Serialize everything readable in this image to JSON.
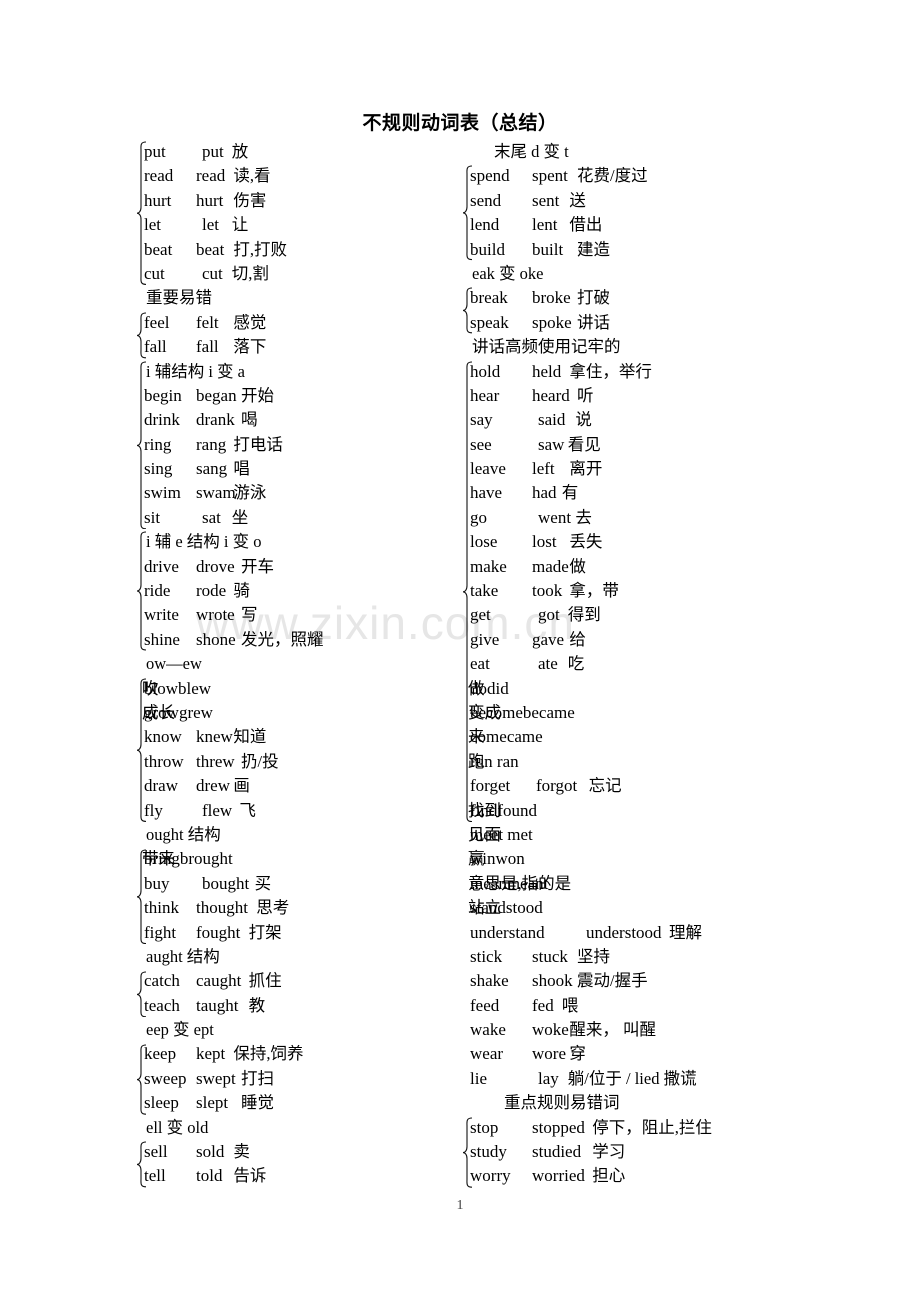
{
  "document": {
    "title": "不规则动词表（总结）",
    "page_number": "1",
    "watermark": "www.zixin.com.cn"
  },
  "left_column": {
    "rows": [
      {
        "kind": "verb",
        "base": "put",
        "past": "put",
        "mean": "放"
      },
      {
        "kind": "verb",
        "base": "read",
        "past": "read",
        "mean": "读,看"
      },
      {
        "kind": "verb",
        "base": "hurt",
        "past": "hurt",
        "mean": "伤害"
      },
      {
        "kind": "verb",
        "base": "let",
        "past": "let",
        "mean": "让"
      },
      {
        "kind": "verb",
        "base": "beat",
        "past": "beat",
        "mean": "打,打败"
      },
      {
        "kind": "verb",
        "base": "cut",
        "past": "cut",
        "mean": "切,割"
      },
      {
        "kind": "rule",
        "text": "重要易错"
      },
      {
        "kind": "verb",
        "base": "feel",
        "past": "felt",
        "mean": "感觉"
      },
      {
        "kind": "verb",
        "base": "fall",
        "past": "fall",
        "mean": "落下"
      },
      {
        "kind": "rule",
        "text": "i 辅结构 i 变 a"
      },
      {
        "kind": "verb",
        "base": "begin",
        "past": "began",
        "mean": "开始"
      },
      {
        "kind": "verb",
        "base": "drink",
        "past": "drank",
        "mean": "喝"
      },
      {
        "kind": "verb",
        "base": "ring",
        "past": "rang",
        "mean": "打电话"
      },
      {
        "kind": "verb",
        "base": "sing",
        "past": "sang",
        "mean": "唱"
      },
      {
        "kind": "verb",
        "base": "swim",
        "past": "swam",
        "mean": "游泳"
      },
      {
        "kind": "verb",
        "base": "sit",
        "past": "sat",
        "mean": "坐"
      },
      {
        "kind": "rule",
        "text": "i 辅 e 结构 i 变 o"
      },
      {
        "kind": "verb",
        "base": "drive",
        "past": "drove",
        "mean": "开车"
      },
      {
        "kind": "verb",
        "base": "ride",
        "past": "rode",
        "mean": "骑"
      },
      {
        "kind": "verb",
        "base": "write",
        "past": "wrote",
        "mean": "写"
      },
      {
        "kind": "verb",
        "base": "shine",
        "past": "shone",
        "mean": "发光，照耀"
      },
      {
        "kind": "rule",
        "text": "ow—ew"
      },
      {
        "kind": "merged",
        "text": "blowblew",
        "mean": "吹"
      },
      {
        "kind": "merged",
        "text": "growgrew",
        "mean": "成长"
      },
      {
        "kind": "verb",
        "base": "know",
        "past": "knew",
        "mean": "知道"
      },
      {
        "kind": "verb",
        "base": "throw",
        "past": "threw",
        "mean": "扔/投"
      },
      {
        "kind": "verb",
        "base": "draw",
        "past": "drew",
        "mean": "画"
      },
      {
        "kind": "verb",
        "base": "fly",
        "past": "flew",
        "mean": "飞"
      },
      {
        "kind": "rule",
        "text": "ought 结构"
      },
      {
        "kind": "merged",
        "text": "bringbrought",
        "mean": "带来"
      },
      {
        "kind": "verb",
        "base": "buy",
        "past": "bought",
        "mean": "买"
      },
      {
        "kind": "verb",
        "base": "think",
        "past": "thought",
        "mean": "思考"
      },
      {
        "kind": "verb",
        "base": "fight",
        "past": "fought",
        "mean": "打架"
      },
      {
        "kind": "rule",
        "text": "aught 结构"
      },
      {
        "kind": "verb",
        "base": "catch",
        "past": "caught",
        "mean": "抓住"
      },
      {
        "kind": "verb",
        "base": "teach",
        "past": "taught",
        "mean": "教"
      },
      {
        "kind": "rule",
        "text": "eep 变 ept"
      },
      {
        "kind": "verb",
        "base": "keep",
        "past": "kept",
        "mean": "保持,饲养"
      },
      {
        "kind": "verb",
        "base": "sweep",
        "past": "swept",
        "mean": "打扫"
      },
      {
        "kind": "verb",
        "base": "sleep",
        "past": "slept",
        "mean": "睡觉"
      },
      {
        "kind": "rule",
        "text": "ell 变 old"
      },
      {
        "kind": "verb",
        "base": "sell",
        "past": "sold",
        "mean": "卖"
      },
      {
        "kind": "verb",
        "base": "tell",
        "past": "told",
        "mean": "告诉"
      }
    ],
    "braces": [
      {
        "from": 0,
        "to": 5
      },
      {
        "from": 7,
        "to": 8
      },
      {
        "from": 9,
        "to": 15
      },
      {
        "from": 16,
        "to": 20
      },
      {
        "from": 22,
        "to": 27
      },
      {
        "from": 29,
        "to": 32
      },
      {
        "from": 34,
        "to": 35
      },
      {
        "from": 37,
        "to": 39
      },
      {
        "from": 41,
        "to": 42
      }
    ]
  },
  "right_column": {
    "rows": [
      {
        "kind": "rule",
        "text": "末尾 d 变 t",
        "indent": 22
      },
      {
        "kind": "verb",
        "base": "spend",
        "past": "spent",
        "mean": "花费/度过"
      },
      {
        "kind": "verb",
        "base": "send",
        "past": "sent",
        "mean": "送"
      },
      {
        "kind": "verb",
        "base": "lend",
        "past": "lent",
        "mean": "借出"
      },
      {
        "kind": "verb",
        "base": "build",
        "past": "built",
        "mean": "建造"
      },
      {
        "kind": "rule",
        "text": "eak 变 oke"
      },
      {
        "kind": "verb",
        "base": "break",
        "past": "broke",
        "mean": "打破"
      },
      {
        "kind": "verb",
        "base": "speak",
        "past": "spoke",
        "mean": "讲话"
      },
      {
        "kind": "rule",
        "text": "讲话高频使用记牢的"
      },
      {
        "kind": "verb",
        "base": "hold",
        "past": "held",
        "mean": "拿住，举行"
      },
      {
        "kind": "verb",
        "base": "hear",
        "past": "heard",
        "mean": "听"
      },
      {
        "kind": "verb",
        "base": "say",
        "past": "said",
        "mean": "说"
      },
      {
        "kind": "verb",
        "base": "see",
        "past": "saw",
        "mean": "看见"
      },
      {
        "kind": "verb",
        "base": "leave",
        "past": "left",
        "mean": "离开"
      },
      {
        "kind": "verb",
        "base": "have",
        "past": "had",
        "mean": "有"
      },
      {
        "kind": "verb",
        "base": "go",
        "past": "went",
        "mean": "去"
      },
      {
        "kind": "verb",
        "base": "lose",
        "past": "lost",
        "mean": "丢失"
      },
      {
        "kind": "verb",
        "base": "make",
        "past": "made",
        "mean": "做"
      },
      {
        "kind": "verb",
        "base": "take",
        "past": "took",
        "mean": "拿，带"
      },
      {
        "kind": "verb",
        "base": "get",
        "past": "got",
        "mean": "得到"
      },
      {
        "kind": "verb",
        "base": "give",
        "past": "gave",
        "mean": "给"
      },
      {
        "kind": "verb",
        "base": "eat",
        "past": "ate",
        "mean": "吃"
      },
      {
        "kind": "merged",
        "text": "dodid",
        "mean": "做"
      },
      {
        "kind": "merged",
        "text": "becomebecame",
        "mean": "变成"
      },
      {
        "kind": "merged",
        "text": "comecame",
        "mean": "来"
      },
      {
        "kind": "merged",
        "text": "run ran",
        "mean": "跑"
      },
      {
        "kind": "verb",
        "base": "forget",
        "past": "forgot",
        "mean": "忘记"
      },
      {
        "kind": "merged",
        "text": "findfound",
        "mean": "找到"
      },
      {
        "kind": "merged",
        "text": "meet met",
        "mean": "见面"
      },
      {
        "kind": "merged",
        "text": "winwon",
        "mean": "赢"
      },
      {
        "kind": "merged",
        "text": "meanmeant",
        "mean": "意思是,指的是"
      },
      {
        "kind": "merged",
        "text": "standstood",
        "mean": "站立"
      },
      {
        "kind": "verb",
        "base": "understand",
        "past": "understood",
        "mean": "理解"
      },
      {
        "kind": "verb",
        "base": "stick",
        "past": "stuck",
        "mean": "坚持"
      },
      {
        "kind": "verb",
        "base": "shake",
        "past": "shook",
        "mean": "震动/握手"
      },
      {
        "kind": "verb",
        "base": "feed",
        "past": "fed",
        "mean": "喂"
      },
      {
        "kind": "verb",
        "base": "wake",
        "past": "woke",
        "mean": "醒来， 叫醒"
      },
      {
        "kind": "verb",
        "base": "wear",
        "past": "wore",
        "mean": "穿"
      },
      {
        "kind": "verb",
        "base": "lie",
        "past": "lay",
        "mean": "躺/位于 / lied 撒谎"
      },
      {
        "kind": "rule",
        "text": "重点规则易错词",
        "indent": 32
      },
      {
        "kind": "verb",
        "base": "stop",
        "past": "stopped",
        "mean": "停下，阻止,拦住"
      },
      {
        "kind": "verb",
        "base": "study",
        "past": "studied",
        "mean": "学习"
      },
      {
        "kind": "verb",
        "base": "worry",
        "past": "worried",
        "mean": "担心"
      }
    ],
    "braces": [
      {
        "from": 1,
        "to": 4
      },
      {
        "from": 6,
        "to": 7
      },
      {
        "from": 9,
        "to": 27
      },
      {
        "from": 40,
        "to": 42
      }
    ]
  }
}
